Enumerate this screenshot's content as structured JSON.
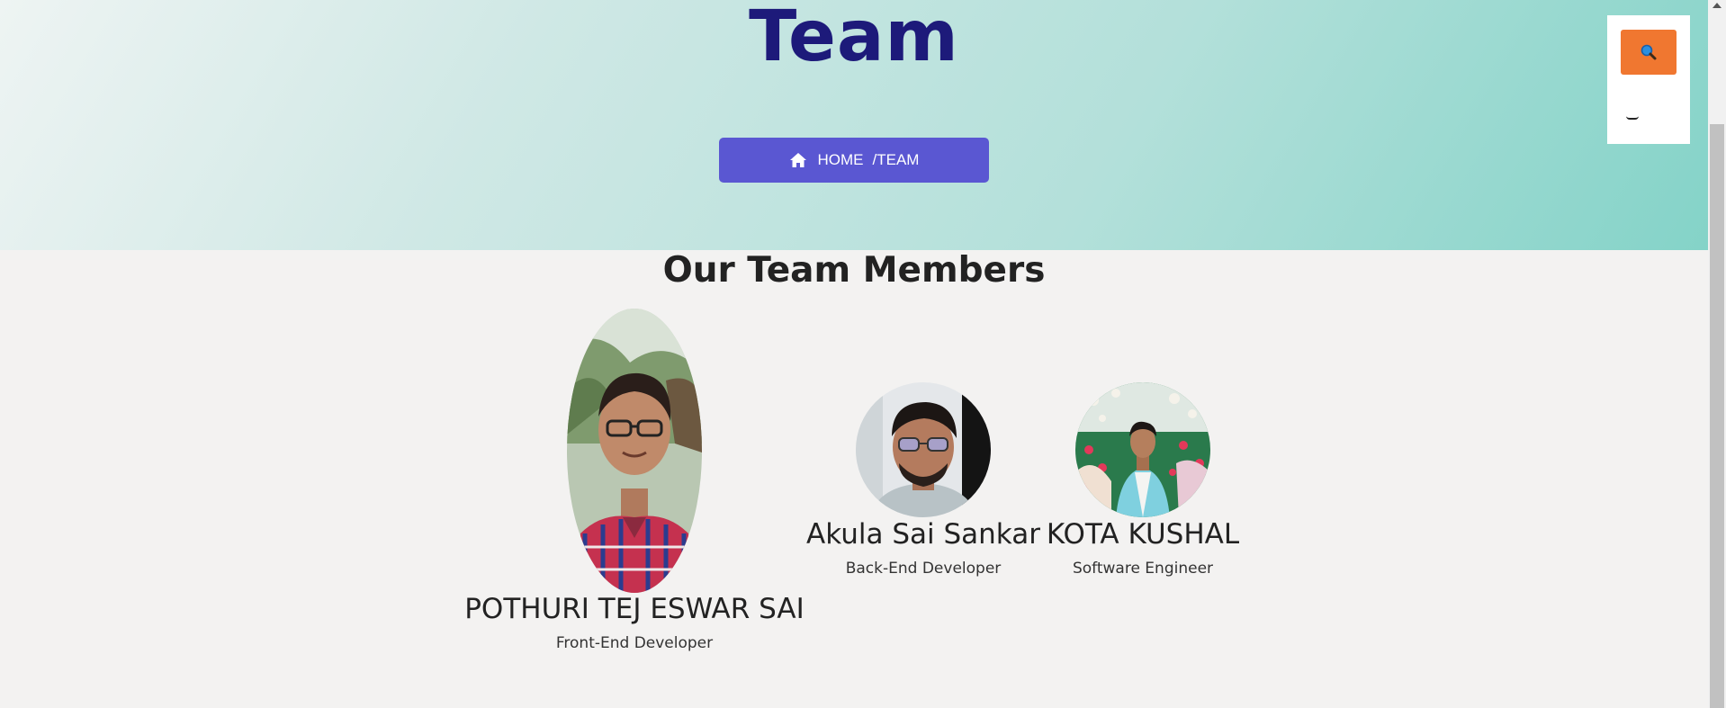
{
  "hero": {
    "title": "Team",
    "breadcrumb": {
      "home": "HOME",
      "current": "/TEAM"
    }
  },
  "side_panel": {
    "search_icon": "search-icon"
  },
  "section": {
    "title": "Our Team Members"
  },
  "members": [
    {
      "name": "POTHURI TEJ ESWAR SAI",
      "role": "Front-End Developer"
    },
    {
      "name": "Akula Sai Sankar",
      "role": "Back-End Developer"
    },
    {
      "name": "KOTA KUSHAL",
      "role": "Software Engineer"
    }
  ],
  "colors": {
    "title": "#1d1a7a",
    "breadcrumb_bg": "#5a57d2",
    "search_bg": "#f07730",
    "hero_gradient_end": "#84d3c8"
  }
}
